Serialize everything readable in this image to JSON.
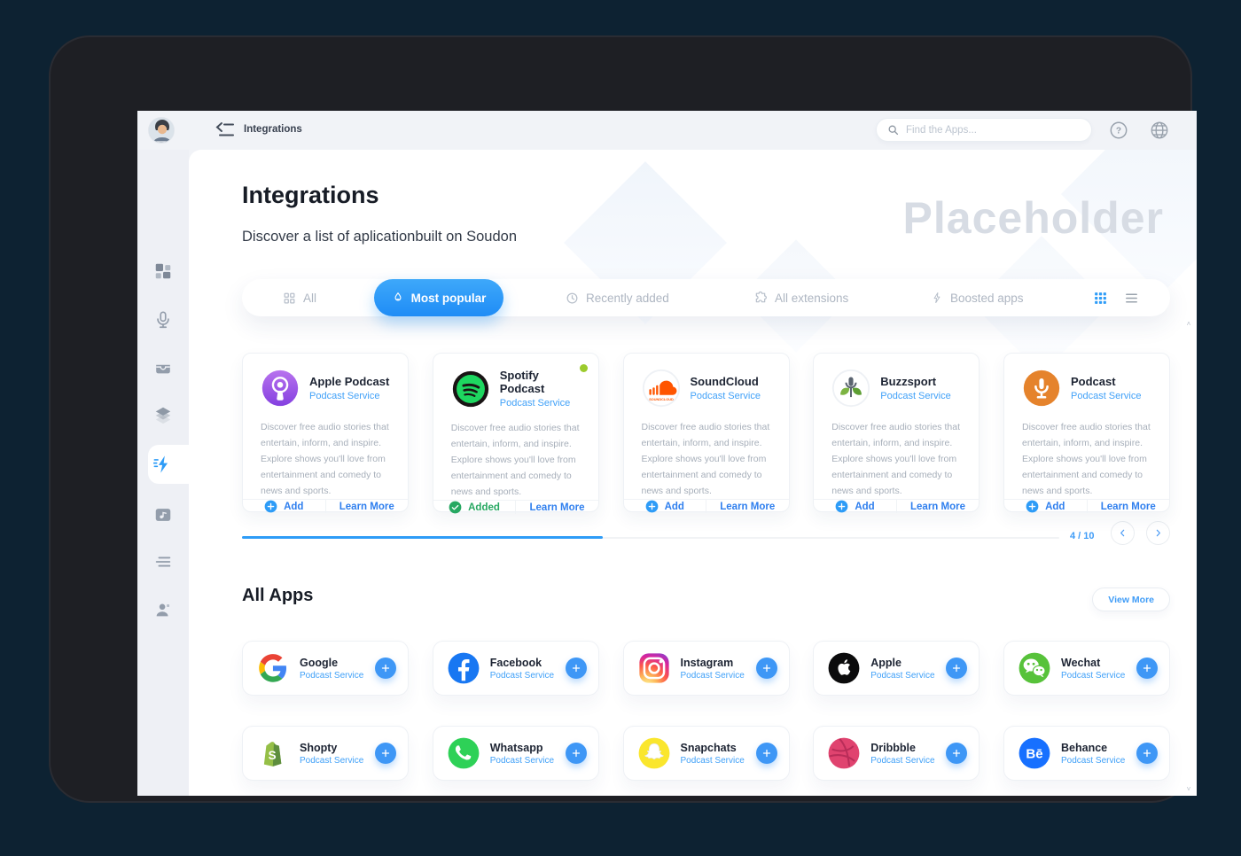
{
  "topbar": {
    "breadcrumb": "Integrations",
    "search_placeholder": "Find the Apps..."
  },
  "header": {
    "title": "Integrations",
    "subtitle": "Discover a list of aplicationbuilt on Soudon",
    "watermark": "Placeholder"
  },
  "filters": {
    "tabs": [
      "All",
      "Most popular",
      "Recently added",
      "All extensions",
      "Boosted apps"
    ]
  },
  "cards": [
    {
      "name": "Apple Podcast",
      "service": "Podcast Service",
      "description": "Discover free audio stories that entertain, inform, and inspire. Explore shows you'll love from entertainment and comedy to news and sports.",
      "action": "Add",
      "learn": "Learn More"
    },
    {
      "name": "Spotify Podcast",
      "service": "Podcast Service",
      "description": "Discover free audio stories that entertain, inform, and inspire. Explore shows you'll love from entertainment and comedy to news and sports.",
      "action": "Added",
      "learn": "Learn More"
    },
    {
      "name": "SoundCloud",
      "service": "Podcast Service",
      "description": "Discover free audio stories that entertain, inform, and inspire. Explore shows you'll love from entertainment and comedy to news and sports.",
      "action": "Add",
      "learn": "Learn More"
    },
    {
      "name": "Buzzsport",
      "service": "Podcast Service",
      "description": "Discover free audio stories that entertain, inform, and inspire. Explore shows you'll love from entertainment and comedy to news and sports.",
      "action": "Add",
      "learn": "Learn More"
    },
    {
      "name": "Podcast",
      "service": "Podcast Service",
      "description": "Discover free audio stories that entertain, inform, and inspire. Explore shows you'll love from entertainment and comedy to news and sports.",
      "action": "Add",
      "learn": "Learn More"
    }
  ],
  "pagination": {
    "label": "4 / 10"
  },
  "all_apps": {
    "title": "All Apps",
    "view_more": "View More",
    "apps": [
      {
        "name": "Google",
        "service": "Podcast Service"
      },
      {
        "name": "Facebook",
        "service": "Podcast Service"
      },
      {
        "name": "Instagram",
        "service": "Podcast Service"
      },
      {
        "name": "Apple",
        "service": "Podcast Service"
      },
      {
        "name": "Wechat",
        "service": "Podcast Service"
      },
      {
        "name": "Shopty",
        "service": "Podcast Service"
      },
      {
        "name": "Whatsapp",
        "service": "Podcast Service"
      },
      {
        "name": "Snapchats",
        "service": "Podcast Service"
      },
      {
        "name": "Dribbble",
        "service": "Podcast Service"
      },
      {
        "name": "Behance",
        "service": "Podcast Service"
      }
    ]
  },
  "colors": {
    "accent_blue": "#2e9cf7",
    "link_blue": "#2f7fee",
    "service_blue": "#41a1f8",
    "added_green": "#27a862",
    "new_dot_green": "#9ccb2d",
    "frame_dark": "#1e1f24",
    "page_dark": "#0d2232"
  }
}
